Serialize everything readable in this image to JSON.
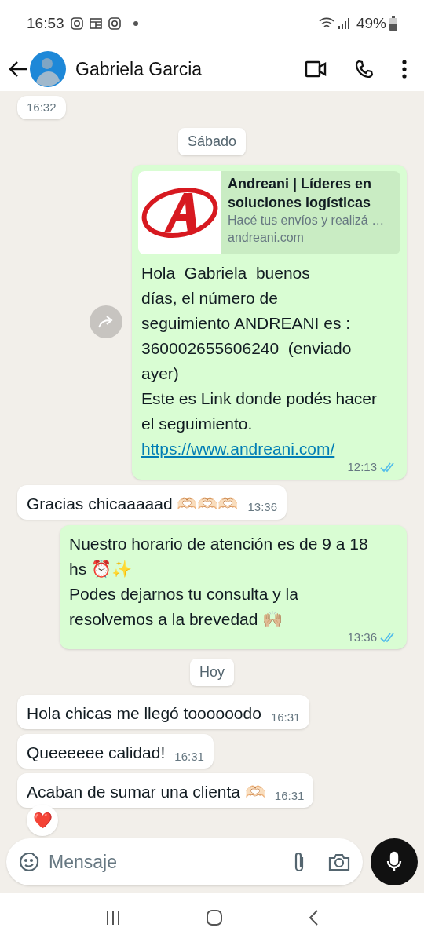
{
  "status_bar": {
    "time": "16:53",
    "battery": "49%"
  },
  "header": {
    "name": "Gabriela Garcia"
  },
  "messages": [
    {
      "kind": "in",
      "time": "16:32"
    },
    {
      "kind": "date",
      "text": "Sábado"
    },
    {
      "kind": "out",
      "forward_button": true,
      "preview": {
        "title": "Andreani | Líderes en soluciones logísticas",
        "description": "Hacé tus envíos y realizá …",
        "domain": "andreani.com"
      },
      "text": "Hola  Gabriela  buenos\ndías, el número de\nseguimiento ANDREANI es :\n360002655606240  (enviado\nayer)\nEste es Link donde podés hacer\nel seguimiento.",
      "link": "https://www.andreani.com/",
      "time": "12:13",
      "read": true
    },
    {
      "kind": "in",
      "text": "Gracias chicaaaaad 🫶🏻🫶🏻🫶🏻",
      "time": "13:36"
    },
    {
      "kind": "out",
      "forward_button": false,
      "text": "Nuestro horario de atención es de 9 a 18 hs ⏰✨\nPodes dejarnos tu consulta y la resolvemos a la brevedad 🙌🏼",
      "time": "13:36",
      "read": true
    },
    {
      "kind": "date",
      "text": "Hoy"
    },
    {
      "kind": "in",
      "text": "Hola chicas me llegó toooooodo",
      "time": "16:31"
    },
    {
      "kind": "in",
      "text": "Queeeeee calidad!",
      "time": "16:31"
    },
    {
      "kind": "in",
      "text": "Acaban de sumar una clienta 🫶🏻",
      "time": "16:31",
      "reaction": "❤️"
    }
  ],
  "composer": {
    "placeholder": "Mensaje"
  }
}
